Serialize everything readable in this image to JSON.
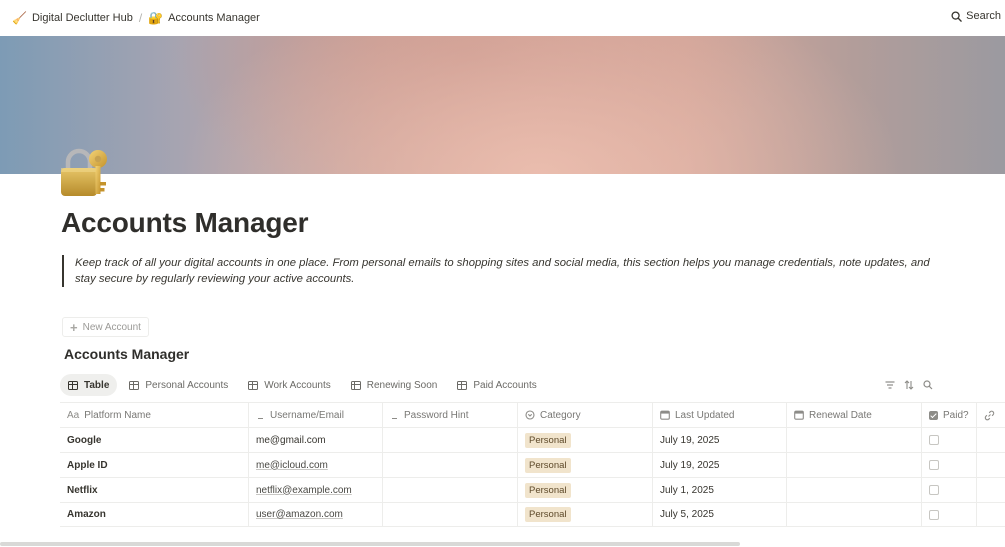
{
  "breadcrumb": [
    {
      "icon": "broom-icon",
      "emoji": "🧹",
      "label": "Digital Declutter Hub"
    },
    {
      "icon": "lock-with-key-icon",
      "emoji": "🔐",
      "label": "Accounts Manager"
    }
  ],
  "breadcrumb_separator": "/",
  "search_label": "Search",
  "page": {
    "icon": "lock-with-key-icon",
    "title": "Accounts Manager",
    "description": "Keep track of all your digital accounts in one place. From personal emails to shopping sites and social media, this section helps you manage credentials, note updates, and stay secure by regularly reviewing your active accounts."
  },
  "new_account_label": "New Account",
  "database": {
    "title": "Accounts Manager",
    "views": [
      "Table",
      "Personal Accounts",
      "Work Accounts",
      "Renewing Soon",
      "Paid Accounts"
    ],
    "active_view": "Table",
    "columns": [
      {
        "label": "Platform Name",
        "icon": "title-aa-icon",
        "glyph": "Aa"
      },
      {
        "label": "Username/Email",
        "icon": "text-lines-icon"
      },
      {
        "label": "Password Hint",
        "icon": "text-lines-icon"
      },
      {
        "label": "Category",
        "icon": "select-circle-icon"
      },
      {
        "label": "Last Updated",
        "icon": "calendar-icon"
      },
      {
        "label": "Renewal Date",
        "icon": "calendar-icon"
      },
      {
        "label": "Paid?",
        "icon": "checkbox-icon"
      },
      {
        "label": "",
        "icon": "link-icon"
      }
    ],
    "rows": [
      {
        "platform": "Google",
        "email": "me@gmail.com",
        "email_link": false,
        "password_hint": "",
        "category": "Personal",
        "last_updated": "July 19, 2025",
        "renewal_date": "",
        "paid": false
      },
      {
        "platform": "Apple ID",
        "email": "me@icloud.com",
        "email_link": true,
        "password_hint": "",
        "category": "Personal",
        "last_updated": "July 19, 2025",
        "renewal_date": "",
        "paid": false
      },
      {
        "platform": "Netflix",
        "email": "netflix@example.com",
        "email_link": true,
        "password_hint": "",
        "category": "Personal",
        "last_updated": "July 1, 2025",
        "renewal_date": "",
        "paid": false
      },
      {
        "platform": "Amazon",
        "email": "user@amazon.com",
        "email_link": true,
        "password_hint": "",
        "category": "Personal",
        "last_updated": "July 5, 2025",
        "renewal_date": "",
        "paid": false
      }
    ]
  },
  "colors": {
    "category_badge_bg": "#f1e4cc",
    "category_badge_text": "#5e4a2a",
    "text_primary": "#37352f",
    "text_muted": "#787774"
  }
}
